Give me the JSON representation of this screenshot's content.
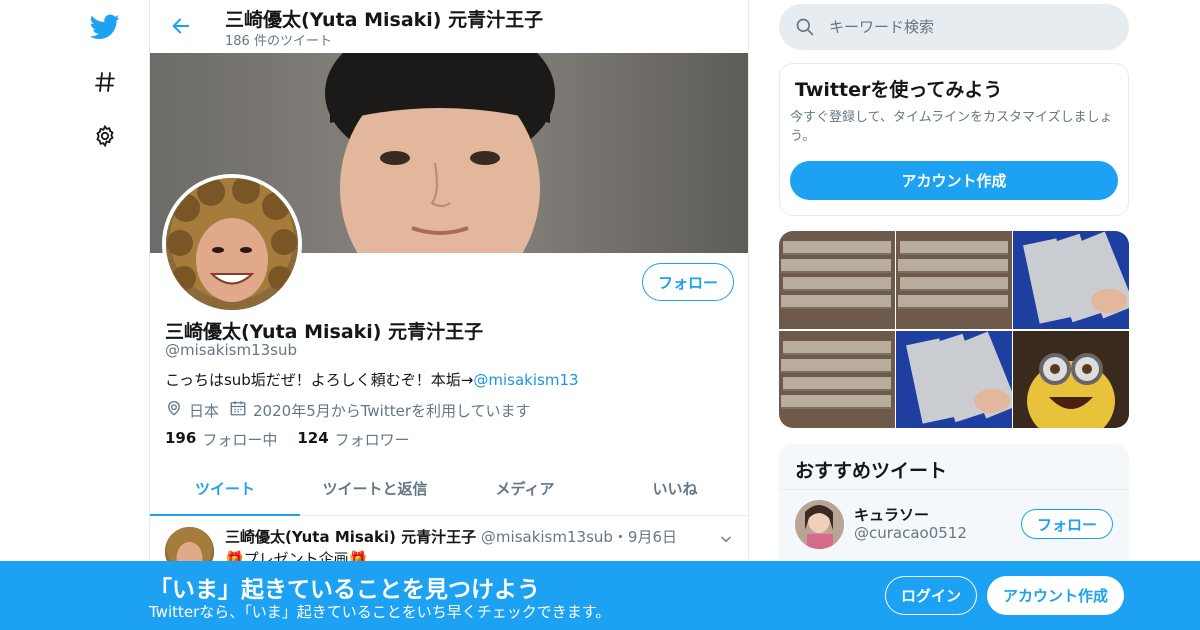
{
  "nav": {
    "icons": [
      "twitter-bird-icon",
      "hashtag-icon",
      "gear-icon"
    ]
  },
  "header": {
    "title": "三崎優太(Yuta Misaki) 元青汁王子",
    "tweet_count": "186 件のツイート"
  },
  "profile": {
    "name": "三崎優太(Yuta Misaki) 元青汁王子",
    "handle": "@misakism13sub",
    "bio_text": "こっちはsub垢だぜ！よろしく頼むぞ！本垢→",
    "bio_mention": "@misakism13",
    "location": "日本",
    "joined": "2020年5月からTwitterを利用しています",
    "following_count": "196",
    "following_label": "フォロー中",
    "followers_count": "124",
    "followers_label": "フォロワー",
    "follow_button": "フォロー"
  },
  "tabs": [
    {
      "label": "ツイート",
      "active": true
    },
    {
      "label": "ツイートと返信",
      "active": false
    },
    {
      "label": "メディア",
      "active": false
    },
    {
      "label": "いいね",
      "active": false
    }
  ],
  "tweet": {
    "name": "三崎優太(Yuta Misaki) 元青汁王子",
    "handle_date": "@misakism13sub・9月6日",
    "text": "🎁プレゼント企画🎁"
  },
  "search": {
    "placeholder": "キーワード検索"
  },
  "signup_box": {
    "title": "Twitterを使ってみよう",
    "description": "今すぐ登録して、タイムラインをカスタマイズしましょう。",
    "button": "アカウント作成"
  },
  "recommended": {
    "title": "おすすめツイート",
    "user_name": "キュラソー",
    "user_handle": "@curacao0512",
    "follow_button": "フォロー"
  },
  "bottom_bar": {
    "title": "「いま」起きていることを見つけよう",
    "subtitle": "Twitterなら、「いま」起きていることをいち早くチェックできます。",
    "login": "ログイン",
    "signup": "アカウント作成"
  },
  "colors": {
    "accent": "#1da1f2",
    "text": "#14171a",
    "muted": "#657786",
    "border": "#e6ecf0"
  }
}
